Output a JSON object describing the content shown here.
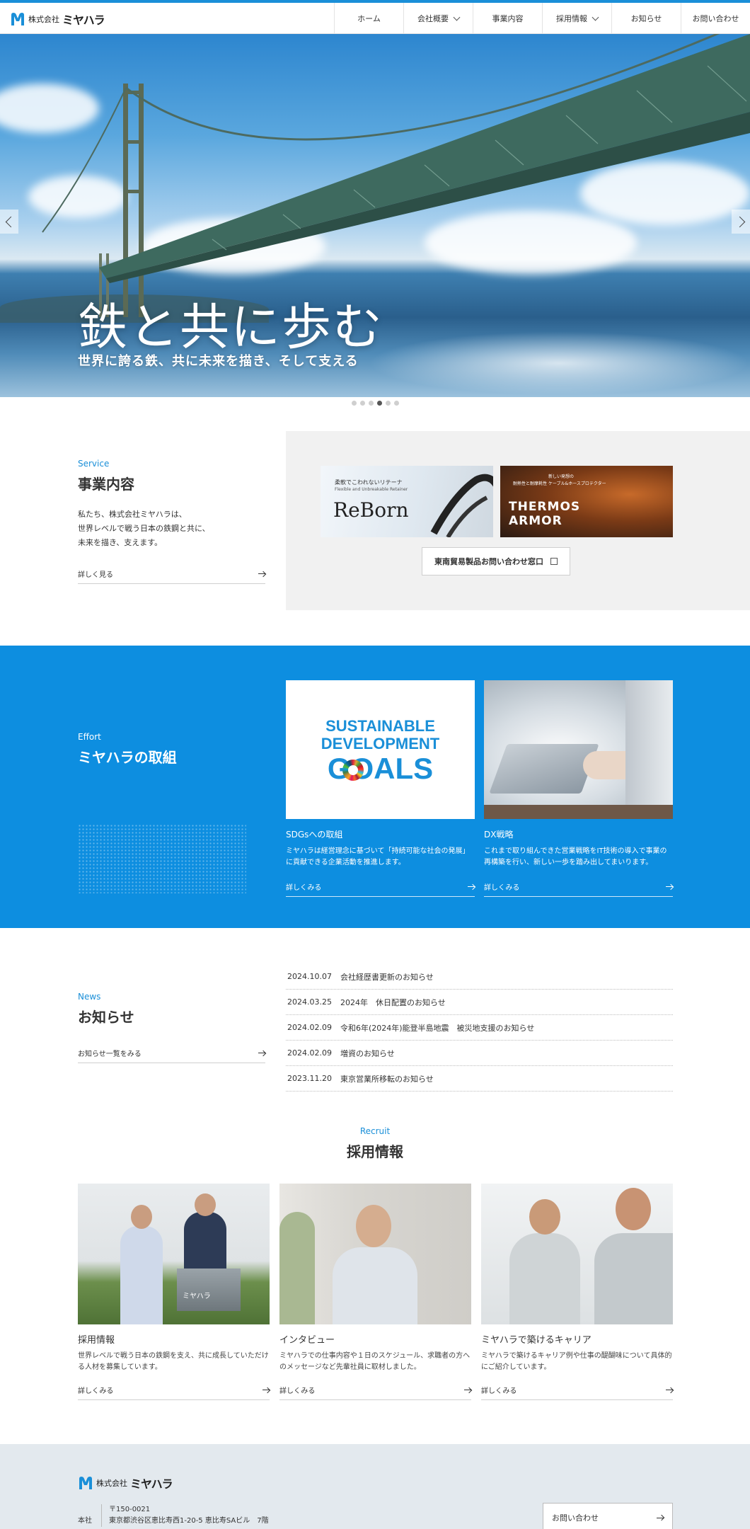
{
  "header": {
    "logo_small": "株式会社",
    "logo_big": "ミヤハラ",
    "nav": [
      {
        "label": "ホーム"
      },
      {
        "label": "会社概要"
      },
      {
        "label": "事業内容"
      },
      {
        "label": "採用情報"
      },
      {
        "label": "お知らせ"
      },
      {
        "label": "お問い合わせ"
      }
    ]
  },
  "hero": {
    "title": "鉄と共に歩む",
    "subtitle": "世界に誇る鉄、共に未来を描き、そして支える",
    "slide_count": 6,
    "active_slide": 4
  },
  "service": {
    "eyebrow": "Service",
    "heading": "事業内容",
    "desc_lines": [
      "私たち、株式会社ミヤハラは、",
      "世界レベルで戦う日本の鉄鋼と共に、",
      "未来を描き、支えます。"
    ],
    "more": "詳しく見る",
    "banner1": {
      "tagline": "柔軟でこわれないリテーナ",
      "tagline_en": "Flexible and Unbreakable Retainer",
      "name": "ReBorn"
    },
    "banner2": {
      "tagline1": "新しい発想の",
      "tagline2": "耐熱性と耐摩耗性 ケーブル&ホースプロテクター",
      "name": "THERMOS ARMOR"
    },
    "contact_label": "東南貿易製品お問い合わせ窓口"
  },
  "effort": {
    "eyebrow": "Effort",
    "heading": "ミヤハラの取組",
    "sdg_text": [
      "SUSTAINABLE",
      "DEVELOPMENT",
      "GOALS"
    ],
    "cards": [
      {
        "title": "SDGsへの取組",
        "desc": "ミヤハラは経営理念に基づいて「持続可能な社会の発展」に貢献できる企業活動を推進します。",
        "more": "詳しくみる"
      },
      {
        "title": "DX戦略",
        "desc": "これまで取り組んできた営業戦略をIT技術の導入で事業の再構築を行い、新しい一歩を踏み出してまいります。",
        "more": "詳しくみる"
      }
    ]
  },
  "news": {
    "eyebrow": "News",
    "heading": "お知らせ",
    "more": "お知らせ一覧をみる",
    "items": [
      {
        "date": "2024.10.07",
        "title": "会社経歴書更新のお知らせ"
      },
      {
        "date": "2024.03.25",
        "title": "2024年　休日配置のお知らせ"
      },
      {
        "date": "2024.02.09",
        "title": "令和6年(2024年)能登半島地震　被災地支援のお知らせ"
      },
      {
        "date": "2024.02.09",
        "title": "増資のお知らせ"
      },
      {
        "date": "2023.11.20",
        "title": "東京営業所移転のお知らせ"
      }
    ]
  },
  "recruit": {
    "eyebrow": "Recruit",
    "heading": "採用情報",
    "cards": [
      {
        "title": "採用情報",
        "desc": "世界レベルで戦う日本の鉄鋼を支え、共に成長していただける人材を募集しています。",
        "more": "詳しくみる"
      },
      {
        "title": "インタビュー",
        "desc": "ミヤハラでの仕事内容や１日のスケジュール、求職者の方へのメッセージなど先輩社員に取材しました。",
        "more": "詳しくみる"
      },
      {
        "title": "ミヤハラで築けるキャリア",
        "desc": "ミヤハラで築けるキャリア例や仕事の醍醐味について具体的にご紹介しています。",
        "more": "詳しくみる"
      }
    ]
  },
  "footer": {
    "logo_small": "株式会社",
    "logo_big": "ミヤハラ",
    "office_label": "本社",
    "postal": "〒150-0021",
    "address": "東京都渋谷区恵比寿西1-20-5 恵比寿SAビル　7階",
    "contact": "お問い合わせ"
  },
  "colors": {
    "accent": "#1a8fd8",
    "effort_bg": "#0d8ee0",
    "panel_bg": "#f1f1f1",
    "footer_bg": "#e3e9ee"
  }
}
